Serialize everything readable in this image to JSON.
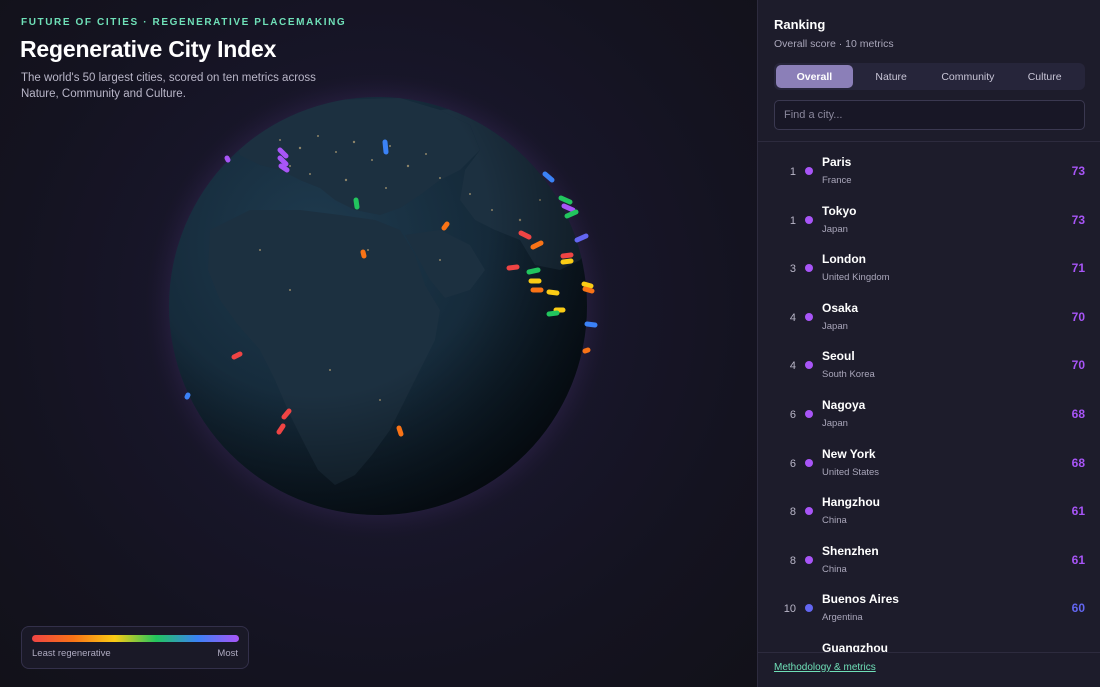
{
  "header": {
    "eyebrow": "FUTURE OF CITIES · REGENERATIVE PLACEMAKING",
    "title": "Regenerative City Index",
    "description": "The world's 50 largest cities, scored on ten metrics across Nature, Community and Culture."
  },
  "legend": {
    "min_label": "Least regenerative",
    "max_label": "Most",
    "colors": [
      "#ef4444",
      "#f97316",
      "#facc15",
      "#22c55e",
      "#3b82f6",
      "#a855f7"
    ]
  },
  "panel": {
    "title": "Ranking",
    "subtitle": "Overall score · 10 metrics",
    "tabs": [
      {
        "label": "Overall",
        "active": true
      },
      {
        "label": "Nature",
        "active": false
      },
      {
        "label": "Community",
        "active": false
      },
      {
        "label": "Culture",
        "active": false
      }
    ],
    "search_placeholder": "Find a city...",
    "cities": [
      {
        "rank": "1",
        "name": "Paris",
        "country": "France",
        "score": "73",
        "color": "#a855f7"
      },
      {
        "rank": "1",
        "name": "Tokyo",
        "country": "Japan",
        "score": "73",
        "color": "#a855f7"
      },
      {
        "rank": "3",
        "name": "London",
        "country": "United Kingdom",
        "score": "71",
        "color": "#a855f7"
      },
      {
        "rank": "4",
        "name": "Osaka",
        "country": "Japan",
        "score": "70",
        "color": "#a855f7"
      },
      {
        "rank": "4",
        "name": "Seoul",
        "country": "South Korea",
        "score": "70",
        "color": "#a855f7"
      },
      {
        "rank": "6",
        "name": "Nagoya",
        "country": "Japan",
        "score": "68",
        "color": "#a855f7"
      },
      {
        "rank": "6",
        "name": "New York",
        "country": "United States",
        "score": "68",
        "color": "#a855f7"
      },
      {
        "rank": "8",
        "name": "Hangzhou",
        "country": "China",
        "score": "61",
        "color": "#a855f7"
      },
      {
        "rank": "8",
        "name": "Shenzhen",
        "country": "China",
        "score": "61",
        "color": "#a855f7"
      },
      {
        "rank": "10",
        "name": "Buenos Aires",
        "country": "Argentina",
        "score": "60",
        "color": "#6366f1"
      },
      {
        "rank": "",
        "name": "Guangzhou",
        "country": "",
        "score": "",
        "color": "#6366f1"
      }
    ],
    "footer_link": "Methodology & metrics"
  },
  "accent": "#6fe0b8",
  "active_tab_color": "#8b7fb8"
}
